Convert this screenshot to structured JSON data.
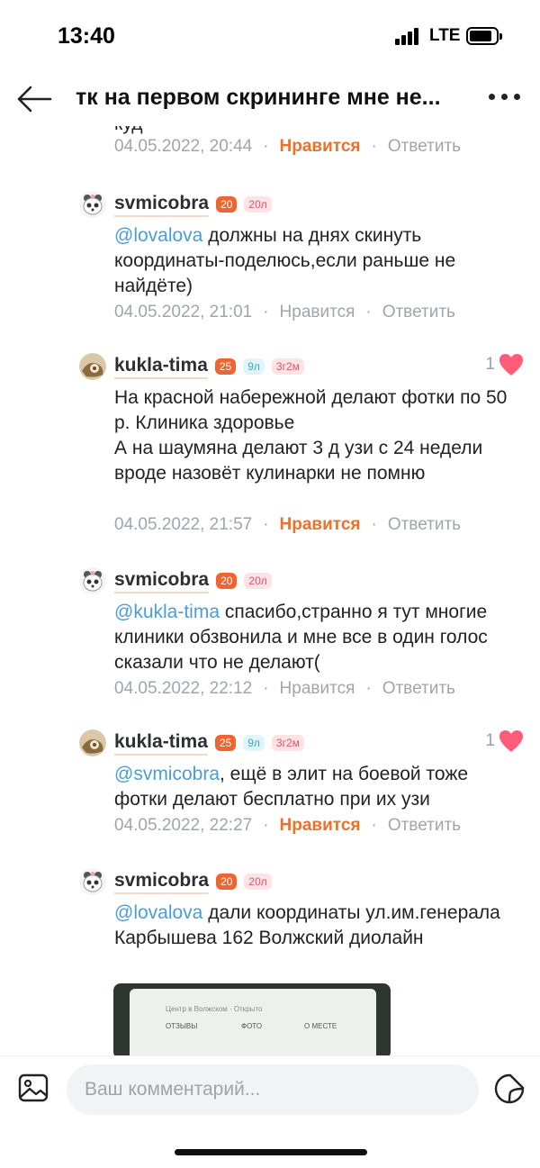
{
  "status_bar": {
    "time": "13:40",
    "network": "LTE"
  },
  "header": {
    "title": "тк на первом скрининге мне не..."
  },
  "feed": {
    "clipped_text": "куд",
    "first_meta": {
      "date": "04.05.2022, 20:44",
      "like_label": "Нравится",
      "reply_label": "Ответить"
    },
    "comments": [
      {
        "author": "svmicobra",
        "badge_age": "20",
        "badge_kid": "20л",
        "mention": "@lovalova",
        "text": " должны на днях скинуть координаты-поделюсь,если раньше не найдёте)",
        "date": "04.05.2022, 21:01",
        "like_label": "Нравится",
        "reply_label": "Ответить"
      },
      {
        "author": "kukla-tima",
        "badge_age": "25",
        "badge_kid": "9л",
        "badge_preg": "3г2м",
        "likes": "1",
        "text": "На красной набережной делают фотки по 50 р. Клиника здоровье\nА на шаумяна делают 3 д узи с 24 недели вроде назовёт кулинарки не помню",
        "date": "04.05.2022, 21:57",
        "like_label": "Нравится",
        "reply_label": "Ответить"
      },
      {
        "author": "svmicobra",
        "badge_age": "20",
        "badge_kid": "20л",
        "mention": "@kukla-tima",
        "text": " спасибо,странно я тут многие клиники обзвонила и мне все в один голос сказали что не делают(",
        "date": "04.05.2022, 22:12",
        "like_label": "Нравится",
        "reply_label": "Ответить"
      },
      {
        "author": "kukla-tima",
        "badge_age": "25",
        "badge_kid": "9л",
        "badge_preg": "3г2м",
        "likes": "1",
        "mention": "@svmicobra",
        "text": ", ещё в элит на боевой тоже фотки делают бесплатно при их узи",
        "date": "04.05.2022, 22:27",
        "like_label": "Нравится",
        "reply_label": "Ответить"
      },
      {
        "author": "svmicobra",
        "badge_age": "20",
        "badge_kid": "20л",
        "mention": "@lovalova",
        "text": "  дали координаты ул.им.генерала Карбышева 162 Волжский диолайн",
        "photo_caption": "Центр в Волжском · Открыто",
        "photo_tabs": [
          "ОТЗЫВЫ",
          "ФОТО",
          "О МЕСТЕ"
        ]
      }
    ]
  },
  "composer": {
    "placeholder": "Ваш комментарий..."
  },
  "colors": {
    "accent": "#e8722c",
    "mention": "#4a9dd6",
    "heart": "#ff5c7a"
  },
  "icons": [
    "back-arrow-icon",
    "more-dots-icon",
    "heart-icon",
    "image-icon",
    "sticker-icon"
  ]
}
